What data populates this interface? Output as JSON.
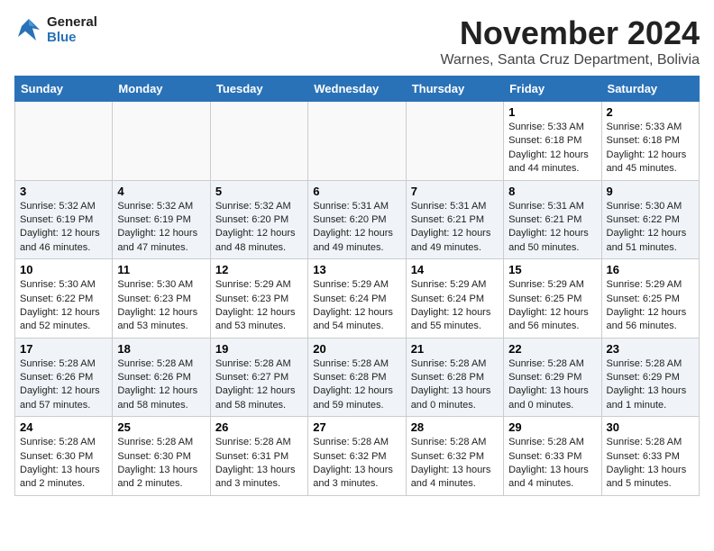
{
  "logo": {
    "line1": "General",
    "line2": "Blue"
  },
  "title": "November 2024",
  "location": "Warnes, Santa Cruz Department, Bolivia",
  "days_of_week": [
    "Sunday",
    "Monday",
    "Tuesday",
    "Wednesday",
    "Thursday",
    "Friday",
    "Saturday"
  ],
  "weeks": [
    [
      {
        "day": "",
        "info": ""
      },
      {
        "day": "",
        "info": ""
      },
      {
        "day": "",
        "info": ""
      },
      {
        "day": "",
        "info": ""
      },
      {
        "day": "",
        "info": ""
      },
      {
        "day": "1",
        "info": "Sunrise: 5:33 AM\nSunset: 6:18 PM\nDaylight: 12 hours\nand 44 minutes."
      },
      {
        "day": "2",
        "info": "Sunrise: 5:33 AM\nSunset: 6:18 PM\nDaylight: 12 hours\nand 45 minutes."
      }
    ],
    [
      {
        "day": "3",
        "info": "Sunrise: 5:32 AM\nSunset: 6:19 PM\nDaylight: 12 hours\nand 46 minutes."
      },
      {
        "day": "4",
        "info": "Sunrise: 5:32 AM\nSunset: 6:19 PM\nDaylight: 12 hours\nand 47 minutes."
      },
      {
        "day": "5",
        "info": "Sunrise: 5:32 AM\nSunset: 6:20 PM\nDaylight: 12 hours\nand 48 minutes."
      },
      {
        "day": "6",
        "info": "Sunrise: 5:31 AM\nSunset: 6:20 PM\nDaylight: 12 hours\nand 49 minutes."
      },
      {
        "day": "7",
        "info": "Sunrise: 5:31 AM\nSunset: 6:21 PM\nDaylight: 12 hours\nand 49 minutes."
      },
      {
        "day": "8",
        "info": "Sunrise: 5:31 AM\nSunset: 6:21 PM\nDaylight: 12 hours\nand 50 minutes."
      },
      {
        "day": "9",
        "info": "Sunrise: 5:30 AM\nSunset: 6:22 PM\nDaylight: 12 hours\nand 51 minutes."
      }
    ],
    [
      {
        "day": "10",
        "info": "Sunrise: 5:30 AM\nSunset: 6:22 PM\nDaylight: 12 hours\nand 52 minutes."
      },
      {
        "day": "11",
        "info": "Sunrise: 5:30 AM\nSunset: 6:23 PM\nDaylight: 12 hours\nand 53 minutes."
      },
      {
        "day": "12",
        "info": "Sunrise: 5:29 AM\nSunset: 6:23 PM\nDaylight: 12 hours\nand 53 minutes."
      },
      {
        "day": "13",
        "info": "Sunrise: 5:29 AM\nSunset: 6:24 PM\nDaylight: 12 hours\nand 54 minutes."
      },
      {
        "day": "14",
        "info": "Sunrise: 5:29 AM\nSunset: 6:24 PM\nDaylight: 12 hours\nand 55 minutes."
      },
      {
        "day": "15",
        "info": "Sunrise: 5:29 AM\nSunset: 6:25 PM\nDaylight: 12 hours\nand 56 minutes."
      },
      {
        "day": "16",
        "info": "Sunrise: 5:29 AM\nSunset: 6:25 PM\nDaylight: 12 hours\nand 56 minutes."
      }
    ],
    [
      {
        "day": "17",
        "info": "Sunrise: 5:28 AM\nSunset: 6:26 PM\nDaylight: 12 hours\nand 57 minutes."
      },
      {
        "day": "18",
        "info": "Sunrise: 5:28 AM\nSunset: 6:26 PM\nDaylight: 12 hours\nand 58 minutes."
      },
      {
        "day": "19",
        "info": "Sunrise: 5:28 AM\nSunset: 6:27 PM\nDaylight: 12 hours\nand 58 minutes."
      },
      {
        "day": "20",
        "info": "Sunrise: 5:28 AM\nSunset: 6:28 PM\nDaylight: 12 hours\nand 59 minutes."
      },
      {
        "day": "21",
        "info": "Sunrise: 5:28 AM\nSunset: 6:28 PM\nDaylight: 13 hours\nand 0 minutes."
      },
      {
        "day": "22",
        "info": "Sunrise: 5:28 AM\nSunset: 6:29 PM\nDaylight: 13 hours\nand 0 minutes."
      },
      {
        "day": "23",
        "info": "Sunrise: 5:28 AM\nSunset: 6:29 PM\nDaylight: 13 hours\nand 1 minute."
      }
    ],
    [
      {
        "day": "24",
        "info": "Sunrise: 5:28 AM\nSunset: 6:30 PM\nDaylight: 13 hours\nand 2 minutes."
      },
      {
        "day": "25",
        "info": "Sunrise: 5:28 AM\nSunset: 6:30 PM\nDaylight: 13 hours\nand 2 minutes."
      },
      {
        "day": "26",
        "info": "Sunrise: 5:28 AM\nSunset: 6:31 PM\nDaylight: 13 hours\nand 3 minutes."
      },
      {
        "day": "27",
        "info": "Sunrise: 5:28 AM\nSunset: 6:32 PM\nDaylight: 13 hours\nand 3 minutes."
      },
      {
        "day": "28",
        "info": "Sunrise: 5:28 AM\nSunset: 6:32 PM\nDaylight: 13 hours\nand 4 minutes."
      },
      {
        "day": "29",
        "info": "Sunrise: 5:28 AM\nSunset: 6:33 PM\nDaylight: 13 hours\nand 4 minutes."
      },
      {
        "day": "30",
        "info": "Sunrise: 5:28 AM\nSunset: 6:33 PM\nDaylight: 13 hours\nand 5 minutes."
      }
    ]
  ]
}
